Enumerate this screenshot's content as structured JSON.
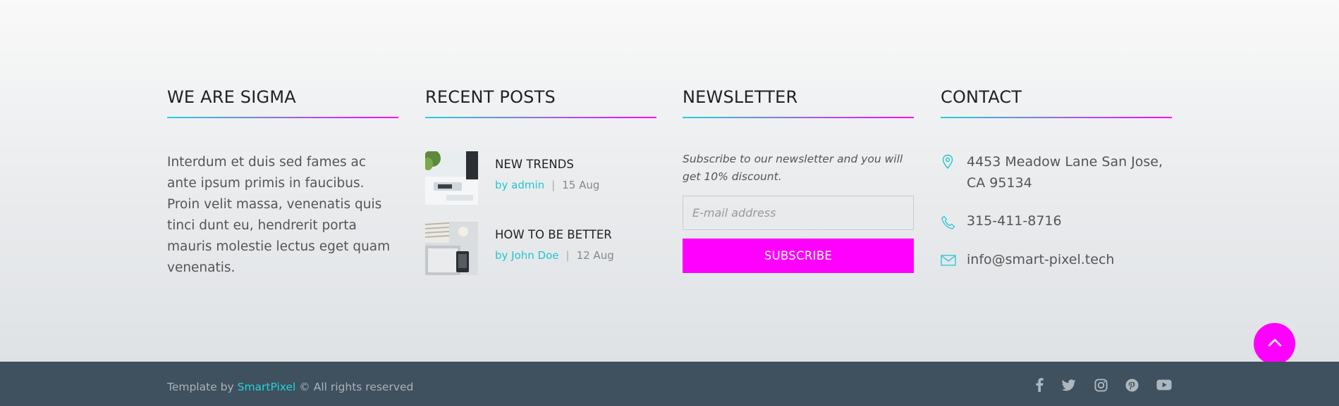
{
  "columns": {
    "about": {
      "title": "WE ARE SIGMA",
      "text": "Interdum et duis sed fames ac ante ipsum primis in faucibus. Proin velit massa, venenatis quis tinci dunt eu, hendrerit porta mauris molestie lectus eget quam venenatis."
    },
    "recent_posts": {
      "title": "RECENT POSTS",
      "posts": [
        {
          "title": "NEW TRENDS",
          "author": "by admin",
          "date": "15 Aug"
        },
        {
          "title": "HOW TO BE BETTER",
          "author": "by John Doe",
          "date": "12 Aug"
        }
      ],
      "separator": "|"
    },
    "newsletter": {
      "title": "NEWSLETTER",
      "text": "Subscribe to our newsletter and you will get 10% discount.",
      "email_placeholder": "E-mail address",
      "button_label": "SUBSCRIBE"
    },
    "contact": {
      "title": "CONTACT",
      "address": "4453 Meadow Lane San Jose, CA 95134",
      "phone": "315-411-8716",
      "email": "info@smart-pixel.tech"
    }
  },
  "footer": {
    "copyright_prefix": "Template by",
    "brand": "SmartPixel",
    "copyright_suffix": "© All rights reserved",
    "social": [
      "facebook-icon",
      "twitter-icon",
      "instagram-icon",
      "pinterest-icon",
      "youtube-icon"
    ]
  },
  "colors": {
    "accent": "#ff00ff",
    "link": "#22d3dc",
    "footer_bar": "#3f505e"
  },
  "back_to_top_icon": "chevron-up-icon"
}
